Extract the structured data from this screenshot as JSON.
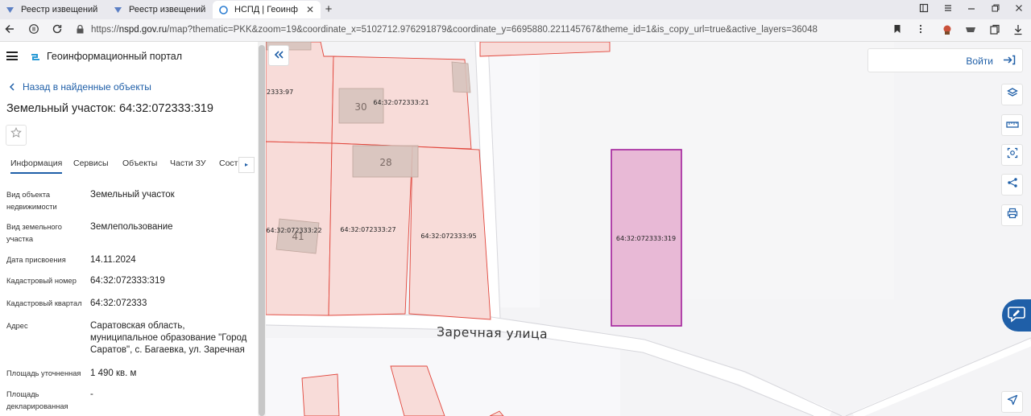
{
  "browser": {
    "tabs": [
      {
        "label": "Реестр извещений"
      },
      {
        "label": "Реестр извещений"
      },
      {
        "label": "НСПД | Геоинформаци"
      }
    ],
    "close_glyph": "✕",
    "newtab_glyph": "+",
    "url_prefix": "https://",
    "url_host": "nspd.gov.ru",
    "url_rest": "/map?thematic=PKK&zoom=19&coordinate_x=5102712.976291879&coordinate_y=6695880.221145767&theme_id=1&is_copy_url=true&active_layers=36048"
  },
  "panel": {
    "portal_name": "Геоинформационный портал",
    "back_label": "Назад в найденные объекты",
    "title": "Земельный участок: 64:32:072333:319",
    "tabs": [
      "Информация",
      "Сервисы",
      "Объекты",
      "Части ЗУ",
      "Сост"
    ],
    "tab_next_glyph": "▸",
    "properties": [
      {
        "key": "Вид объекта недвижимости",
        "value": "Земельный участок"
      },
      {
        "key": "Вид земельного участка",
        "value": "Землепользование"
      },
      {
        "key": "Дата присвоения",
        "value": "14.11.2024"
      },
      {
        "key": "Кадастровый номер",
        "value": "64:32:072333:319"
      },
      {
        "key": "Кадастровый квартал",
        "value": "64:32:072333"
      },
      {
        "key": "Адрес",
        "value": "Саратовская область, муниципальное образование \"Город Саратов\", с. Багаевка, ул. Заречная"
      },
      {
        "key": "Площадь уточненная",
        "value": "1 490 кв. м"
      },
      {
        "key": "Площадь декларированная",
        "value": "-"
      }
    ]
  },
  "map": {
    "street_name": "Заречная  улица",
    "selected_parcel": "64:32:072333:319",
    "parcel_labels": [
      "64:32:072333:21",
      "64:32:072333:22",
      "64:32:072333:27",
      "64:32:072333:95",
      "2333:97"
    ],
    "building_numbers": [
      "30",
      "28",
      "41"
    ],
    "login_label": "Войти",
    "colors": {
      "parcel_fill": "#f8dcd9",
      "parcel_stroke": "#e1463c",
      "building_fill": "#d6c3bd",
      "selected_fill": "#e8b9d6",
      "selected_stroke": "#a2209b",
      "accent": "#1f5fa8"
    }
  },
  "icons": [
    "hamburger-icon",
    "portal-logo-icon",
    "back-chevron-icon",
    "star-icon",
    "collapse-panel-icon",
    "login-icon",
    "layers-icon",
    "ruler-icon",
    "select-area-icon",
    "share-icon",
    "print-icon",
    "help-chat-icon",
    "navigation-arrow-icon"
  ]
}
